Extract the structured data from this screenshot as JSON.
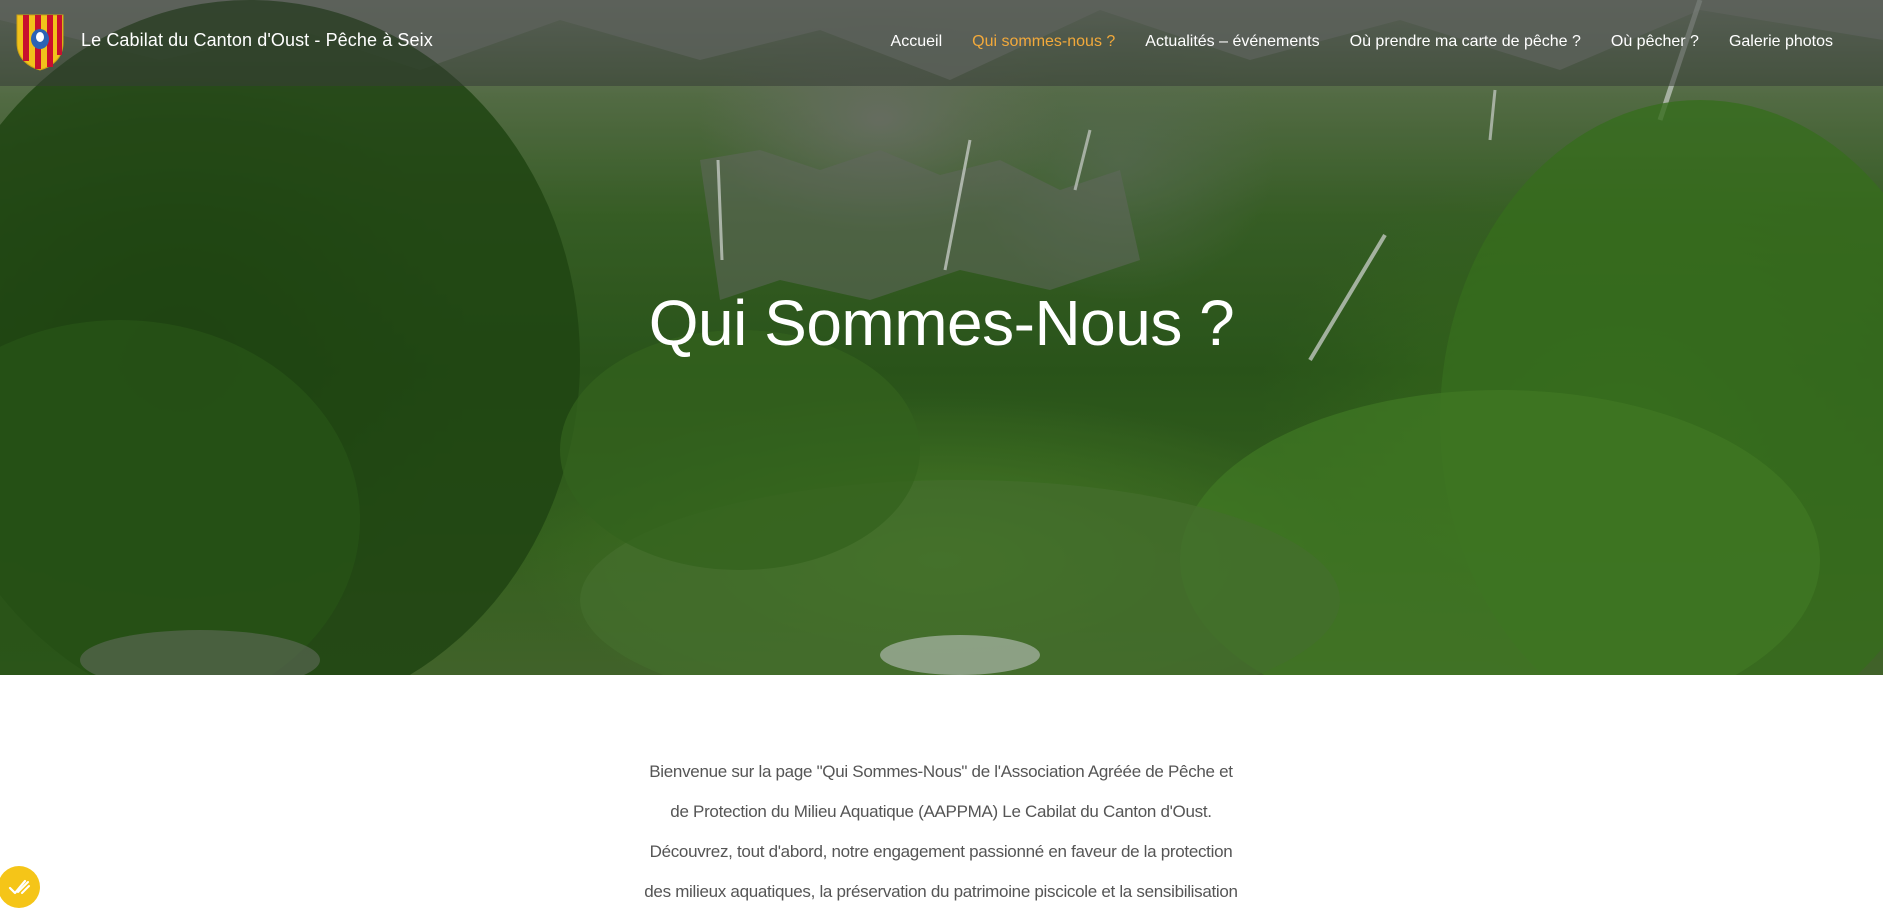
{
  "header": {
    "site_title": "Le Cabilat du Canton d'Oust - Pêche à Seix",
    "logo_icon": "coat-of-arms-icon",
    "nav": [
      {
        "label": "Accueil",
        "active": false
      },
      {
        "label": "Qui sommes-nous ?",
        "active": true
      },
      {
        "label": "Actualités – événements",
        "active": false
      },
      {
        "label": "Où prendre ma carte de pêche ?",
        "active": false
      },
      {
        "label": "Où pêcher ?",
        "active": false
      },
      {
        "label": "Galerie photos",
        "active": false
      }
    ],
    "active_color": "#f2a93b"
  },
  "hero": {
    "title": "Qui Sommes-Nous ?"
  },
  "content": {
    "lines": [
      "Bienvenue sur la page \"Qui Sommes-Nous\" de l'Association Agréée de Pêche et",
      "de Protection du Milieu Aquatique (AAPPMA) Le Cabilat du Canton d'Oust.",
      "Découvrez, tout d'abord, notre engagement passionné en faveur de la protection",
      "des milieux aquatiques, la préservation du patrimoine piscicole et la sensibilisation"
    ]
  },
  "consent": {
    "icon": "cookie-consent-check-icon",
    "color": "#f5c518"
  }
}
